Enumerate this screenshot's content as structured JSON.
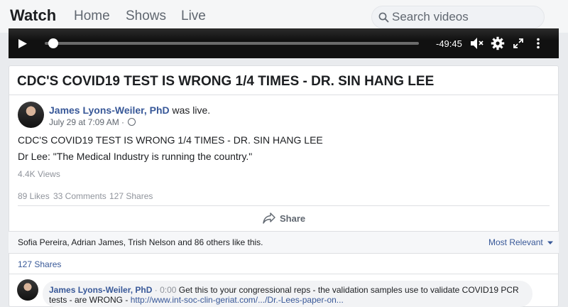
{
  "nav": {
    "brand": "Watch",
    "links": [
      "Home",
      "Shows",
      "Live"
    ],
    "search_placeholder": "Search videos"
  },
  "player": {
    "time_remaining": "-49:45",
    "progress": 0.01
  },
  "post": {
    "header_title": "CDC'S COVID19 TEST IS WRONG 1/4 TIMES - DR. SIN HANG LEE",
    "author": "James Lyons-Weiler, PhD",
    "author_suffix": "was live.",
    "date": "July 29 at 7:09 AM · ",
    "text_line1": "CDC'S COVID19 TEST IS WRONG 1/4 TIMES - DR. SIN HANG LEE",
    "text_line2": "Dr Lee: \"The Medical Industry is running the country.\"",
    "views": "4.4K Views",
    "likes": "89 Likes",
    "comments": "33 Comments",
    "shares": "127 Shares",
    "share_label": "Share",
    "liked_by": "Sofia Pereira, Adrian James, Trish Nelson and 86 others like this.",
    "sort_label": "Most Relevant",
    "shares_link": "127 Shares"
  },
  "comment": {
    "author": "James Lyons-Weiler, PhD",
    "time": "0:00",
    "text1": "Get this to your congressional reps - the validation samples use to validate COVID19 PCR",
    "text2": "tests - are WRONG - ",
    "link": "http://www.int-soc-clin-geriat.com/.../Dr.-Lees-paper-on..."
  }
}
